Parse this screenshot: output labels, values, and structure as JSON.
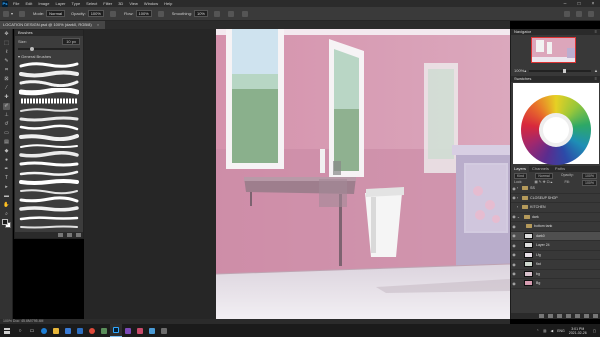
{
  "app": {
    "menus": [
      "File",
      "Edit",
      "Image",
      "Layer",
      "Type",
      "Select",
      "Filter",
      "3D",
      "View",
      "Window",
      "Help"
    ]
  },
  "options_bar": {
    "mode_label": "Mode:",
    "mode_value": "Normal",
    "opacity_label": "Opacity:",
    "opacity_value": "100%",
    "flow_label": "Flow:",
    "flow_value": "100%",
    "smoothing_label": "Smoothing:",
    "smoothing_value": "10%"
  },
  "document_tab": {
    "title": "LOCATION DESIGN.psd @ 100% (dark0, RGB/8)"
  },
  "brushes_panel": {
    "title": "Brushes",
    "size_label": "Size:",
    "size_value": "10 px",
    "folder": "General Brushes"
  },
  "navigator": {
    "title": "Navigator",
    "zoom": "100%"
  },
  "swatches": {
    "title": "Swatches"
  },
  "layers": {
    "tabs": [
      "Layers",
      "Channels",
      "Paths"
    ],
    "kind_label": "Kind",
    "blend_mode": "Normal",
    "opacity_label": "Opacity:",
    "opacity_value": "100%",
    "lock_label": "Lock:",
    "fill_label": "Fill:",
    "fill_value": "100%",
    "rows": [
      {
        "name": "SS",
        "type": "folder"
      },
      {
        "name": "CLOSEUP SHOP",
        "type": "folder"
      },
      {
        "name": "KITCHEN",
        "type": "folder"
      },
      {
        "name": "dark",
        "type": "folder"
      },
      {
        "name": "bottom tank",
        "type": "folder"
      },
      {
        "name": "dark0",
        "type": "layer"
      },
      {
        "name": "Layer 24",
        "type": "layer"
      },
      {
        "name": "Lfg",
        "type": "layer"
      },
      {
        "name": "flat",
        "type": "layer"
      },
      {
        "name": "bg",
        "type": "layer"
      },
      {
        "name": "Bg",
        "type": "layer"
      }
    ]
  },
  "status_bar": {
    "text": "100%    Doc: 45.6M/795.4M"
  },
  "taskbar": {
    "language": "ENG",
    "time": "3:01 PM",
    "date": "2021-02-26"
  },
  "colors": {
    "wall_pink": "#d69cb1",
    "floor": "#e9e3ea",
    "ps_blue": "#31a8ff"
  }
}
